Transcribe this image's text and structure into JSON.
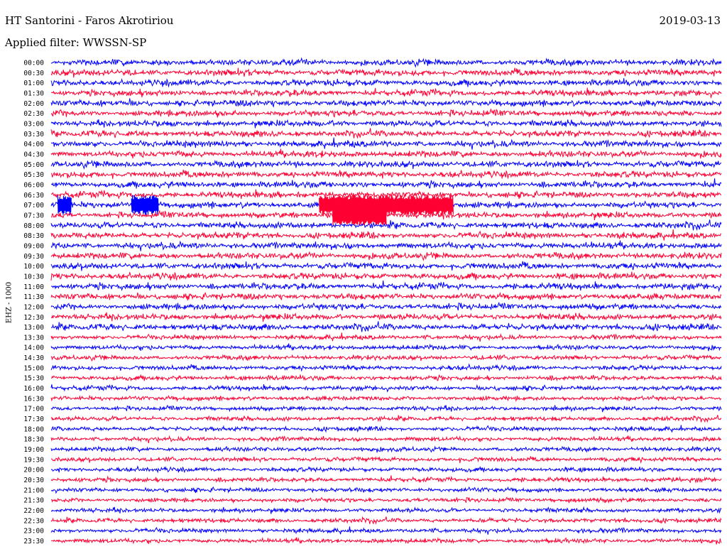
{
  "header": {
    "station": "HT Santorini - Faros Akrotiriou",
    "date": "2019-03-13",
    "filter": "Applied filter: WWSSN-SP"
  },
  "channel_label": "EHZ - 1000",
  "colors": {
    "trace_odd": "#0000ff",
    "trace_even": "#ff0033",
    "background": "#ffffff",
    "text": "#000000"
  },
  "chart_data": {
    "type": "line",
    "subtype": "helicorder",
    "title": "HT Santorini - Faros Akrotiriou",
    "xlabel": "",
    "ylabel": "EHZ - 1000",
    "grid": false,
    "legend": "none",
    "row_labels": [
      "00:00",
      "00:30",
      "01:00",
      "01:30",
      "02:00",
      "02:30",
      "03:00",
      "03:30",
      "04:00",
      "04:30",
      "05:00",
      "05:30",
      "06:00",
      "06:30",
      "07:00",
      "07:30",
      "08:00",
      "08:30",
      "09:00",
      "09:30",
      "10:00",
      "10:30",
      "11:00",
      "11:30",
      "12:00",
      "12:30",
      "13:00",
      "13:30",
      "14:00",
      "14:30",
      "15:00",
      "15:30",
      "16:00",
      "16:30",
      "17:00",
      "17:30",
      "18:00",
      "18:30",
      "19:00",
      "19:30",
      "20:00",
      "20:30",
      "21:00",
      "21:30",
      "22:00",
      "22:30",
      "23:00",
      "23:30"
    ],
    "row_colors": [
      "blue",
      "red"
    ],
    "events": [
      {
        "row": "07:00",
        "color": "red",
        "start_fraction": 0.4,
        "end_fraction": 0.6
      },
      {
        "row": "07:00",
        "color": "blue",
        "start_fraction": 0.01,
        "end_fraction": 0.03
      },
      {
        "row": "07:00",
        "color": "blue",
        "start_fraction": 0.12,
        "end_fraction": 0.16
      },
      {
        "row": "07:30",
        "color": "red",
        "start_fraction": 0.42,
        "end_fraction": 0.5
      }
    ]
  }
}
